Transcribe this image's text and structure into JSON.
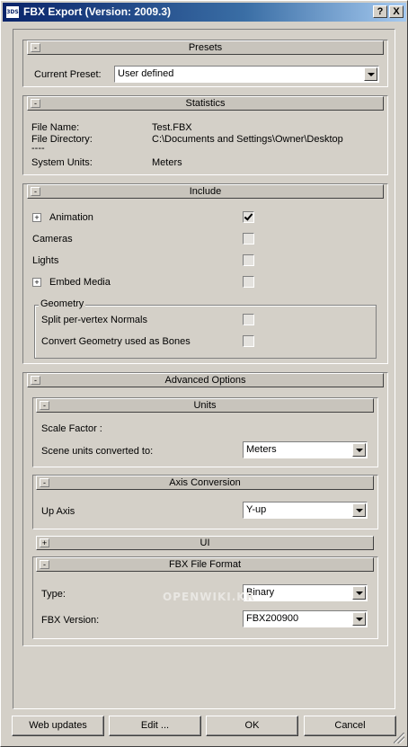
{
  "window": {
    "title": "FBX Export (Version: 2009.3)",
    "icon_text": "3DS",
    "help_button": "?",
    "close_button": "X"
  },
  "presets": {
    "header": "Presets",
    "toggle": "-",
    "current_preset_label": "Current Preset:",
    "current_preset_value": "User defined"
  },
  "statistics": {
    "header": "Statistics",
    "toggle": "-",
    "file_name_label": "File Name:",
    "file_name_value": "Test.FBX",
    "file_directory_label": "File Directory:",
    "file_directory_value": "C:\\Documents and Settings\\Owner\\Desktop",
    "separator": "----",
    "system_units_label": "System Units:",
    "system_units_value": "Meters"
  },
  "include": {
    "header": "Include",
    "toggle": "-",
    "items": [
      {
        "label": "Animation",
        "expand": "+",
        "checked": true
      },
      {
        "label": "Cameras",
        "checked": false
      },
      {
        "label": "Lights",
        "checked": false
      },
      {
        "label": "Embed Media",
        "expand": "+",
        "checked": false
      }
    ],
    "geometry": {
      "title": "Geometry",
      "items": [
        {
          "label": "Split per-vertex Normals",
          "checked": false
        },
        {
          "label": "Convert Geometry used as Bones",
          "checked": false
        }
      ]
    }
  },
  "advanced": {
    "header": "Advanced Options",
    "toggle": "-",
    "units": {
      "header": "Units",
      "toggle": "-",
      "scale_factor_label": "Scale Factor :",
      "scene_units_label": "Scene units converted to:",
      "scene_units_value": "Meters"
    },
    "axis_conversion": {
      "header": "Axis Conversion",
      "toggle": "-",
      "up_axis_label": "Up Axis",
      "up_axis_value": "Y-up"
    },
    "ui": {
      "header": "UI",
      "toggle": "+"
    },
    "fbx_file_format": {
      "header": "FBX File Format",
      "toggle": "-",
      "type_label": "Type:",
      "type_value": "Binary",
      "version_label": "FBX Version:",
      "version_value": "FBX200900"
    }
  },
  "watermark": "OPENWIKI.KR",
  "buttons": {
    "web_updates": "Web updates",
    "edit": "Edit ...",
    "ok": "OK",
    "cancel": "Cancel"
  }
}
